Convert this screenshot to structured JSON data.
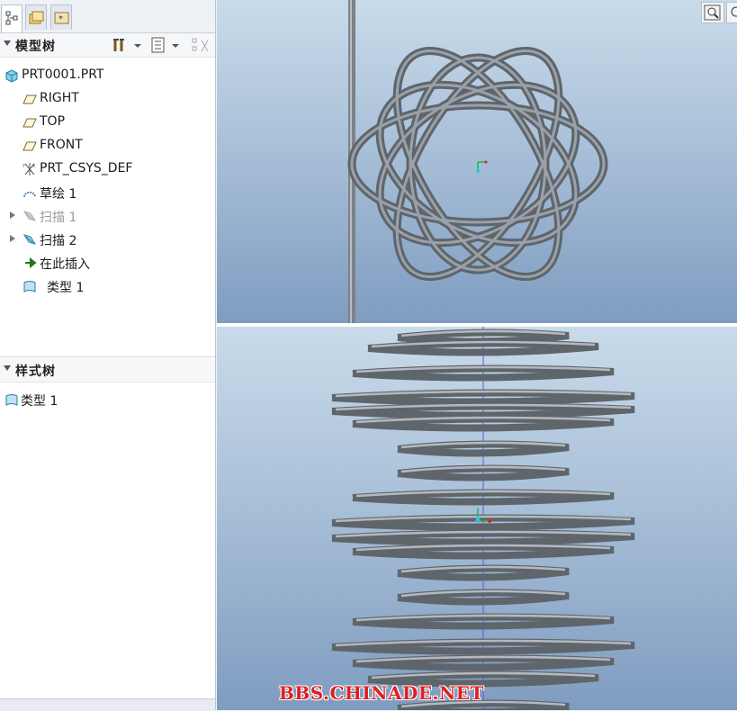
{
  "model_tree": {
    "title": "模型树",
    "items": [
      {
        "label": "PRT0001.PRT",
        "icon": "part-icon"
      },
      {
        "label": "RIGHT",
        "icon": "datum-plane-icon"
      },
      {
        "label": "TOP",
        "icon": "datum-plane-icon"
      },
      {
        "label": "FRONT",
        "icon": "datum-plane-icon"
      },
      {
        "label": "PRT_CSYS_DEF",
        "icon": "csys-icon"
      },
      {
        "label": "草绘 1",
        "icon": "sketch-icon"
      },
      {
        "label": "扫描 1",
        "icon": "sweep-icon",
        "state": "suppressed"
      },
      {
        "label": "扫描 2",
        "icon": "sweep-icon"
      },
      {
        "label": "在此插入",
        "icon": "insert-arrow-icon"
      },
      {
        "label": "类型 1",
        "icon": "style-icon"
      }
    ]
  },
  "style_tree": {
    "title": "样式树",
    "items": [
      {
        "label": "类型 1",
        "icon": "style-icon"
      }
    ]
  },
  "watermark": "BBS.CHINADE.NET",
  "colors": {
    "viewport_top": "#c9dbea",
    "viewport_bottom": "#7f9cc0",
    "spring": "#6e757c",
    "watermark": "#e02020"
  }
}
